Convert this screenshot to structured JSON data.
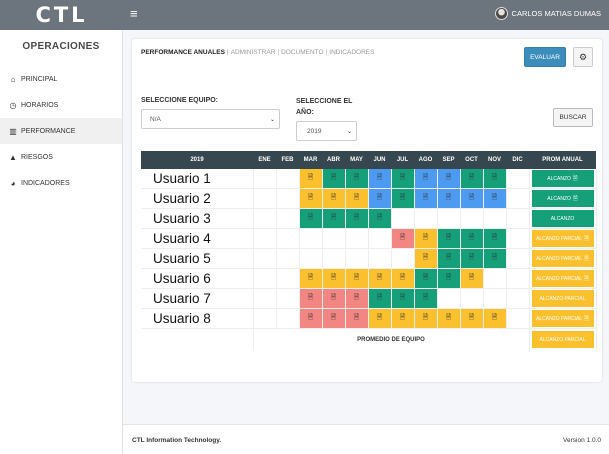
{
  "brand": {
    "logo": "CTL"
  },
  "topbar": {
    "menu_icon": "hamburger-icon",
    "user_name": "CARLOS MATIAS DUMAS"
  },
  "sidebar": {
    "title": "OPERACIONES",
    "items": [
      {
        "label": "PRINCIPAL",
        "icon": "home-icon",
        "active": false
      },
      {
        "label": "HORARIOS",
        "icon": "clock-icon",
        "active": false
      },
      {
        "label": "PERFORMANCE",
        "icon": "chart-icon",
        "active": true
      },
      {
        "label": "RIESGOS",
        "icon": "warning-icon",
        "active": false
      },
      {
        "label": "INDICADORES",
        "icon": "pie-chart-icon",
        "active": false
      }
    ]
  },
  "tabs": {
    "active": "PERFORMANCE ANUALES",
    "others": [
      "ADMINISTRAR",
      "DOCUMENTO",
      "INDICADORES"
    ]
  },
  "buttons": {
    "evaluar": "EVALUAR",
    "settings_icon": "gear-icon",
    "buscar": "BUSCAR"
  },
  "filters": {
    "equipo_label": "SELECCIONE EQUIPO:",
    "equipo_value": "N/A",
    "year_label": "SELECCIONE EL AÑO:",
    "year_value": "2019"
  },
  "table": {
    "year_header": "2019",
    "months": [
      "ENE",
      "FEB",
      "MAR",
      "ABR",
      "MAY",
      "JUN",
      "JUL",
      "AGO",
      "SEP",
      "OCT",
      "NOV",
      "DIC"
    ],
    "prom_header": "PROM ANUAL",
    "colors": {
      "y": "#fbc02d",
      "g": "#15a07a",
      "b": "#4c9bf0",
      "r": "#f28683"
    },
    "rows": [
      {
        "name": "Usuario 1",
        "cells": [
          "",
          "",
          "y",
          "g",
          "g",
          "b",
          "g",
          "b",
          "b",
          "g",
          "g",
          ""
        ],
        "prom": {
          "label": "ALCANZO",
          "color": "g",
          "icon": true
        }
      },
      {
        "name": "Usuario 2",
        "cells": [
          "",
          "",
          "y",
          "y",
          "y",
          "b",
          "g",
          "b",
          "b",
          "b",
          "b",
          ""
        ],
        "prom": {
          "label": "ALCANZO",
          "color": "g",
          "icon": true
        }
      },
      {
        "name": "Usuario 3",
        "cells": [
          "",
          "",
          "g",
          "g",
          "g",
          "g",
          "",
          "",
          "",
          "",
          "",
          ""
        ],
        "prom": {
          "label": "ALCANZO",
          "color": "g",
          "icon": false
        }
      },
      {
        "name": "Usuario 4",
        "cells": [
          "",
          "",
          "",
          "",
          "",
          "",
          "r",
          "y",
          "g",
          "g",
          "g",
          ""
        ],
        "prom": {
          "label": "ALCANZO PARCIAL",
          "color": "y",
          "icon": true
        }
      },
      {
        "name": "Usuario 5",
        "cells": [
          "",
          "",
          "",
          "",
          "",
          "",
          "",
          "y",
          "g",
          "g",
          "g",
          ""
        ],
        "prom": {
          "label": "ALCANZO PARCIAL",
          "color": "y",
          "icon": true
        }
      },
      {
        "name": "Usuario 6",
        "cells": [
          "",
          "",
          "y",
          "y",
          "y",
          "y",
          "y",
          "g",
          "g",
          "y",
          "",
          ""
        ],
        "prom": {
          "label": "ALCANZO PARCIAL",
          "color": "y",
          "icon": true
        }
      },
      {
        "name": "Usuario 7",
        "cells": [
          "",
          "",
          "r",
          "r",
          "r",
          "g",
          "g",
          "g",
          "",
          "",
          "",
          ""
        ],
        "prom": {
          "label": "ALCANZO PARCIAL",
          "color": "y",
          "icon": false
        }
      },
      {
        "name": "Usuario 8",
        "cells": [
          "",
          "",
          "r",
          "r",
          "r",
          "y",
          "y",
          "y",
          "y",
          "y",
          "y",
          ""
        ],
        "prom": {
          "label": "ALCANZO PARCIAL",
          "color": "y",
          "icon": true
        }
      }
    ],
    "promedio_label": "PROMEDIO DE EQUIPO",
    "promedio_value": {
      "label": "ALCANZO PARCIAL",
      "color": "y"
    }
  },
  "footer": {
    "company": "CTL Information Technology.",
    "version": "Version 1.0.0"
  }
}
